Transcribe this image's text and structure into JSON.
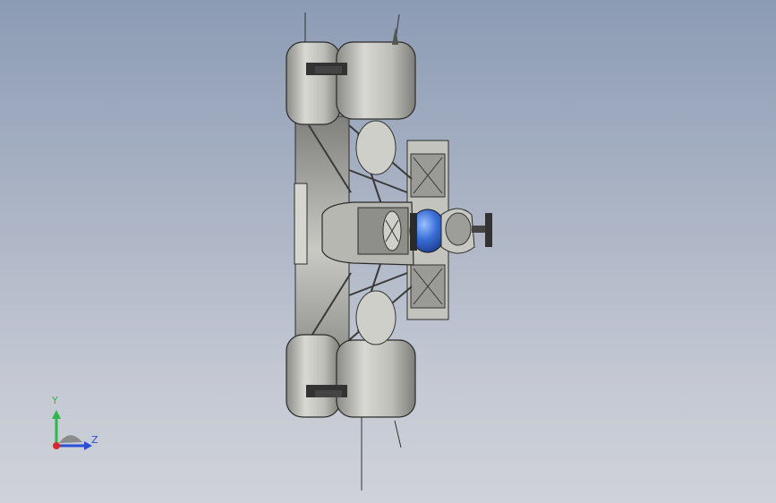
{
  "viewport": {
    "background_top": "#8c9cb5",
    "background_bottom": "#cfd2d9"
  },
  "model": {
    "body_color": "#a9a9a6",
    "tire_color": "#b8b8b4",
    "edge_color": "#2b2b2b",
    "helmet_color": "#3a6fd8"
  },
  "triad": {
    "y_label": "Y",
    "z_label": "Z",
    "y_color": "#2db84a",
    "z_color": "#2a4fd6",
    "x_color": "#d62a2a"
  }
}
